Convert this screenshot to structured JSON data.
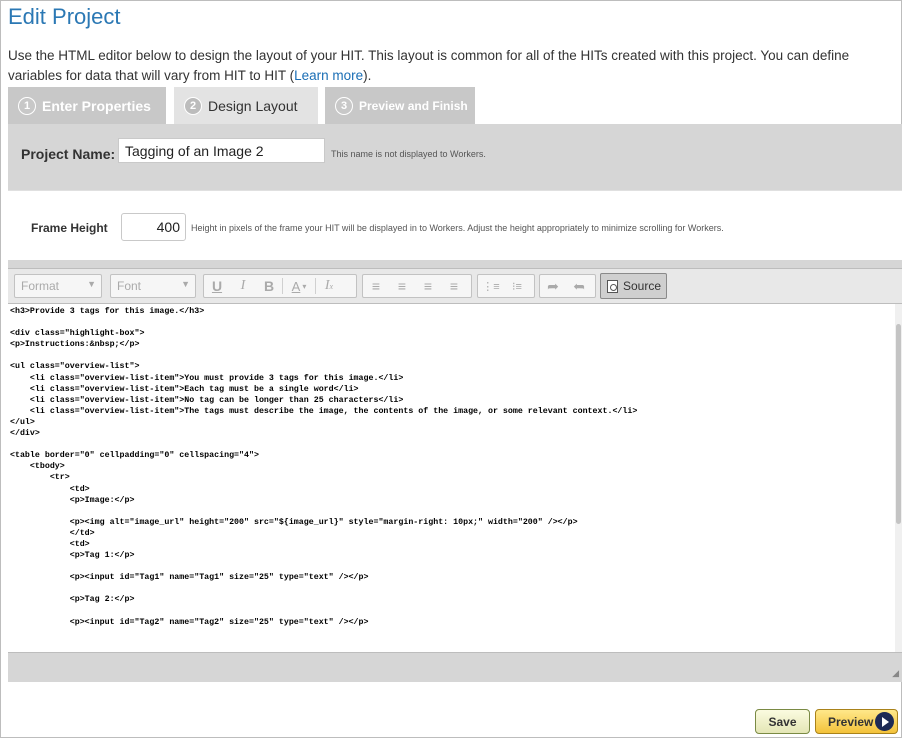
{
  "page": {
    "title": "Edit Project",
    "intro_text": "Use the HTML editor below to design the layout of your HIT. This layout is common for all of the HITs created with this project. You can define variables for data that will vary from HIT to HIT (",
    "intro_link": "Learn more",
    "intro_end": ")."
  },
  "tabs": [
    {
      "num": "1",
      "label": "Enter Properties"
    },
    {
      "num": "2",
      "label": "Design Layout"
    },
    {
      "num": "3",
      "label": "Preview and Finish"
    }
  ],
  "project": {
    "label": "Project Name:",
    "value": "Tagging of an Image 2",
    "hint": "This name is not displayed to Workers."
  },
  "frame": {
    "label": "Frame Height",
    "value": "400",
    "hint": "Height in pixels of the frame your HIT will be displayed in to Workers. Adjust the height appropriately to minimize scrolling for Workers."
  },
  "toolbar": {
    "format": "Format",
    "font": "Font",
    "source": "Source"
  },
  "editor": {
    "code": "<h3>Provide 3 tags for this image.</h3>\n\n<div class=\"highlight-box\">\n<p>Instructions:&nbsp;</p>\n\n<ul class=\"overview-list\">\n    <li class=\"overview-list-item\">You must provide 3 tags for this image.</li>\n    <li class=\"overview-list-item\">Each tag must be a single word</li>\n    <li class=\"overview-list-item\">No tag can be longer than 25 characters</li>\n    <li class=\"overview-list-item\">The tags must describe the image, the contents of the image, or some relevant context.</li>\n</ul>\n</div>\n\n<table border=\"0\" cellpadding=\"0\" cellspacing=\"4\">\n    <tbody>\n        <tr>\n            <td>\n            <p>Image:</p>\n\n            <p><img alt=\"image_url\" height=\"200\" src=\"${image_url}\" style=\"margin-right: 10px;\" width=\"200\" /></p>\n            </td>\n            <td>\n            <p>Tag 1:</p>\n\n            <p><input id=\"Tag1\" name=\"Tag1\" size=\"25\" type=\"text\" /></p>\n\n            <p>Tag 2:</p>\n\n            <p><input id=\"Tag2\" name=\"Tag2\" size=\"25\" type=\"text\" /></p>"
  },
  "buttons": {
    "save": "Save",
    "preview": "Preview"
  }
}
